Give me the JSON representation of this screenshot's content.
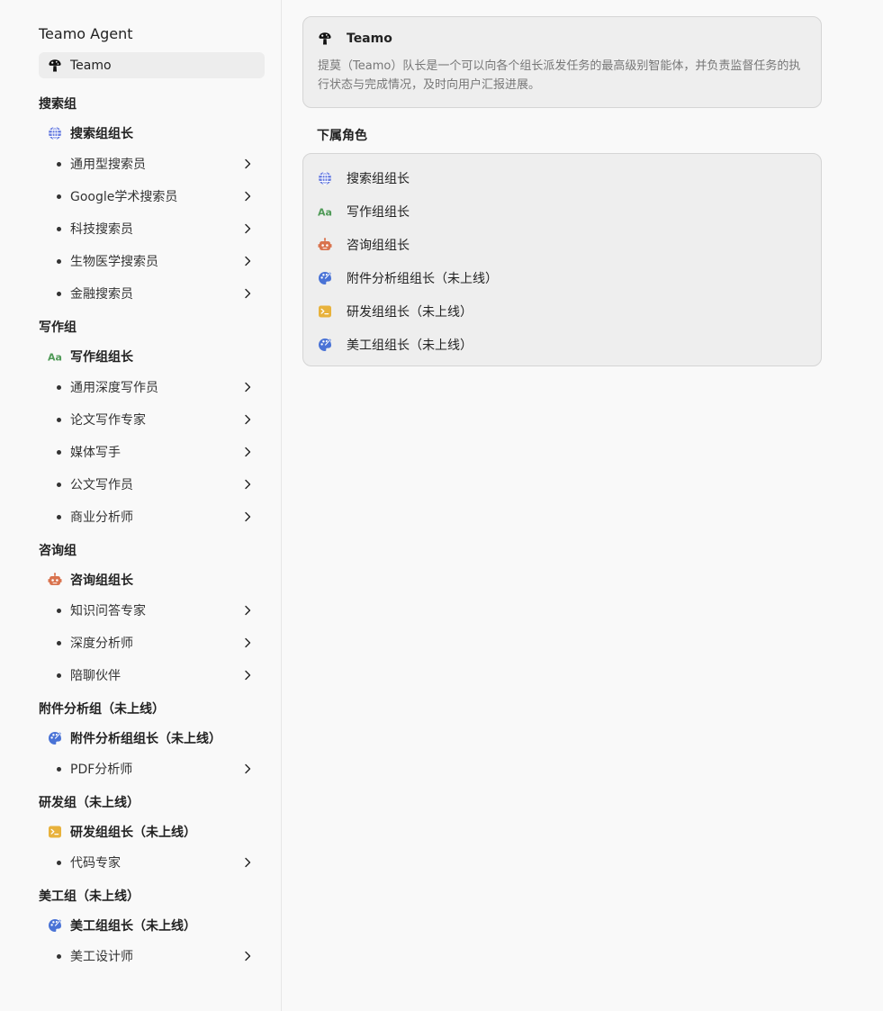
{
  "app": {
    "title": "Teamo Agent"
  },
  "top": {
    "label": "Teamo",
    "icon": "mushroom-icon"
  },
  "groups": [
    {
      "title": "搜索组",
      "leader": {
        "label": "搜索组组长",
        "icon": "globe-icon"
      },
      "members": [
        "通用型搜索员",
        "Google学术搜索员",
        "科技搜索员",
        "生物医学搜索员",
        "金融搜索员"
      ]
    },
    {
      "title": "写作组",
      "leader": {
        "label": "写作组组长",
        "icon": "font-icon"
      },
      "members": [
        "通用深度写作员",
        "论文写作专家",
        "媒体写手",
        "公文写作员",
        "商业分析师"
      ]
    },
    {
      "title": "咨询组",
      "leader": {
        "label": "咨询组组长",
        "icon": "robot-icon"
      },
      "members": [
        "知识问答专家",
        "深度分析师",
        "陪聊伙伴"
      ]
    },
    {
      "title": "附件分析组（未上线）",
      "leader": {
        "label": "附件分析组组长（未上线）",
        "icon": "palette-icon"
      },
      "members": [
        "PDF分析师"
      ]
    },
    {
      "title": "研发组（未上线）",
      "leader": {
        "label": "研发组组长（未上线）",
        "icon": "terminal-icon"
      },
      "members": [
        "代码专家"
      ]
    },
    {
      "title": "美工组（未上线）",
      "leader": {
        "label": "美工组组长（未上线）",
        "icon": "palette-icon"
      },
      "members": [
        "美工设计师"
      ]
    }
  ],
  "main": {
    "card": {
      "title": "Teamo",
      "description": "提莫（Teamo）队长是一个可以向各个组长派发任务的最高级别智能体，并负责监督任务的执行状态与完成情况，及时向用户汇报进展。"
    },
    "subordinates_title": "下属角色",
    "subordinates": [
      {
        "label": "搜索组组长",
        "icon": "globe-icon"
      },
      {
        "label": "写作组组长",
        "icon": "font-icon"
      },
      {
        "label": "咨询组组长",
        "icon": "robot-icon"
      },
      {
        "label": "附件分析组组长（未上线）",
        "icon": "palette-icon"
      },
      {
        "label": "研发组组长（未上线）",
        "icon": "terminal-icon"
      },
      {
        "label": "美工组组长（未上线）",
        "icon": "palette-icon"
      }
    ]
  },
  "colors": {
    "globe": "#6b7fe0",
    "font": "#4f9a57",
    "robot": "#d9734e",
    "palette": "#4a73d6",
    "terminal": "#e8b23c"
  }
}
